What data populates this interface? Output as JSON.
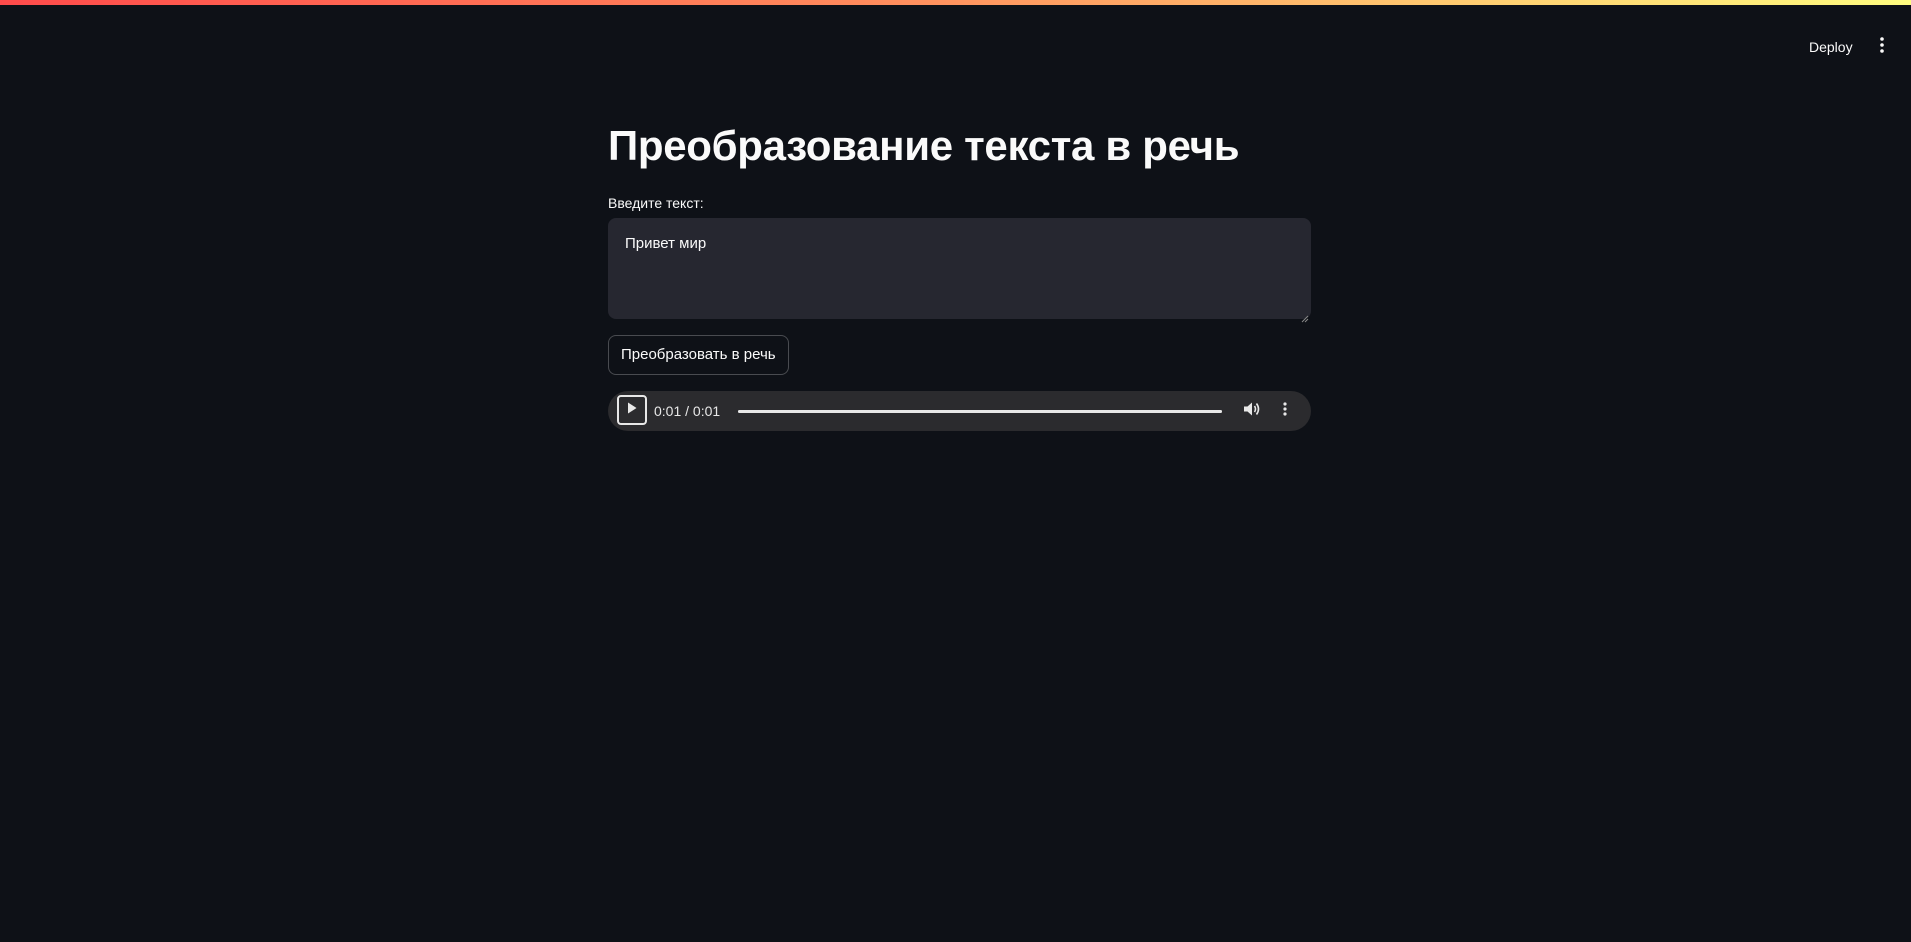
{
  "header": {
    "deploy_label": "Deploy",
    "menu_icon": "kebab-menu-icon"
  },
  "main": {
    "title": "Преобразование текста в речь",
    "input_label": "Введите текст:",
    "input_value": "Привет мир",
    "convert_button_label": "Преобразовать в речь"
  },
  "audio": {
    "time_display": "0:01 / 0:01",
    "progress": 1.0,
    "play_icon": "play-icon",
    "volume_icon": "volume-icon",
    "options_icon": "kebab-menu-icon"
  },
  "colors": {
    "background": "#0e1117",
    "input_background": "#262730",
    "text": "#fafafa",
    "accent_gradient_start": "#ff4b4b",
    "accent_gradient_end": "#fffd80"
  }
}
